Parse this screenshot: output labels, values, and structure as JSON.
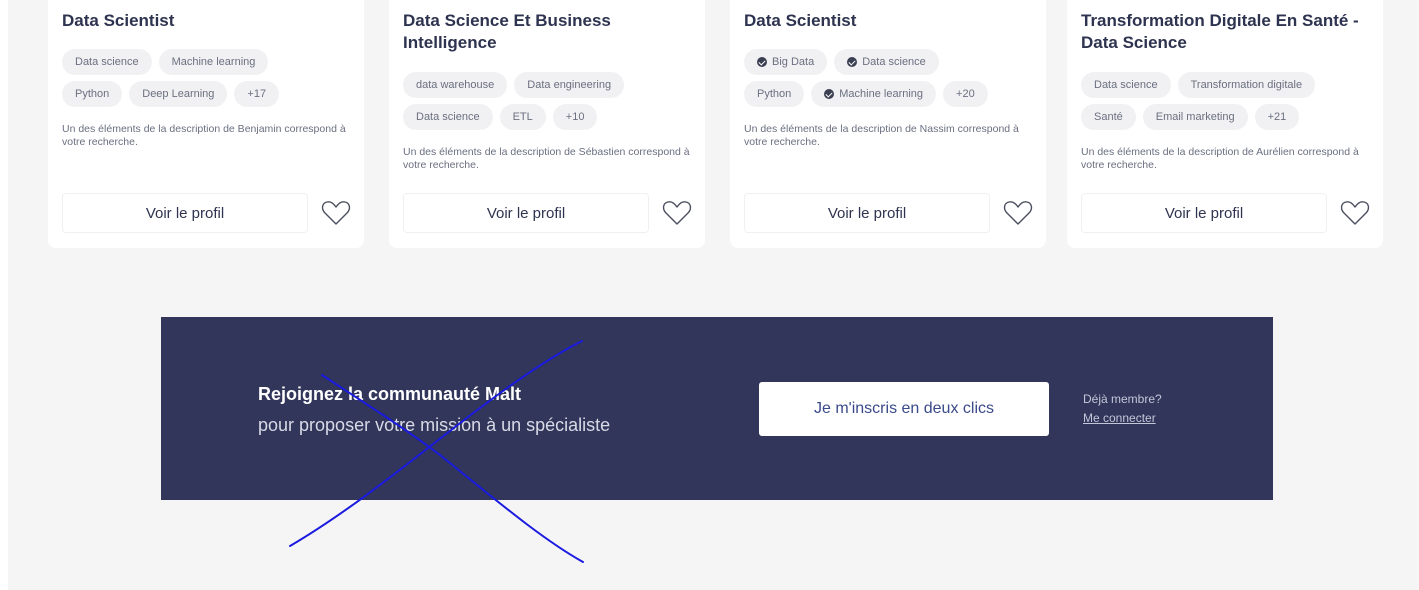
{
  "cards": [
    {
      "title": "Data Scientist",
      "tag_rows": [
        [
          {
            "label": "Data science",
            "verified": false
          },
          {
            "label": "Machine learning",
            "verified": false
          }
        ],
        [
          {
            "label": "Python",
            "verified": false
          },
          {
            "label": "Deep Learning",
            "verified": false
          },
          {
            "label": "+17",
            "verified": false
          }
        ]
      ],
      "description": "Un des éléments de la description de Benjamin correspond à votre recherche.",
      "button_label": "Voir le profil"
    },
    {
      "title": "Data Science Et Business Intelligence",
      "tag_rows": [
        [
          {
            "label": "data warehouse",
            "verified": false
          },
          {
            "label": "Data engineering",
            "verified": false
          }
        ],
        [
          {
            "label": "Data science",
            "verified": false
          },
          {
            "label": "ETL",
            "verified": false
          },
          {
            "label": "+10",
            "verified": false
          }
        ]
      ],
      "description": "Un des éléments de la description de Sébastien correspond à votre recherche.",
      "button_label": "Voir le profil"
    },
    {
      "title": "Data Scientist",
      "tag_rows": [
        [
          {
            "label": "Big Data",
            "verified": true
          },
          {
            "label": "Data science",
            "verified": true
          }
        ],
        [
          {
            "label": "Python",
            "verified": false
          },
          {
            "label": "Machine learning",
            "verified": true
          },
          {
            "label": "+20",
            "verified": false
          }
        ]
      ],
      "description": "Un des éléments de la description de Nassim correspond à votre recherche.",
      "button_label": "Voir le profil"
    },
    {
      "title": "Transformation Digitale En Santé - Data Science",
      "tag_rows": [
        [
          {
            "label": "Data science",
            "verified": false
          },
          {
            "label": "Transformation digitale",
            "verified": false
          }
        ],
        [
          {
            "label": "Santé",
            "verified": false
          },
          {
            "label": "Email marketing",
            "verified": false
          },
          {
            "label": "+21",
            "verified": false
          }
        ]
      ],
      "description": "Un des éléments de la description de Aurélien correspond à votre recherche.",
      "button_label": "Voir le profil"
    }
  ],
  "banner": {
    "title": "Rejoignez la communauté Malt",
    "subtitle": "pour proposer votre mission à un spécialiste",
    "signup_label": "Je m'inscris en deux clics",
    "member_question": "Déjà membre?",
    "login_label": "Me connecter"
  },
  "colors": {
    "banner_bg": "#31365a",
    "title_text": "#2e3450",
    "tag_bg": "#f1f1f3",
    "annotation_stroke": "#1a1ae0"
  }
}
